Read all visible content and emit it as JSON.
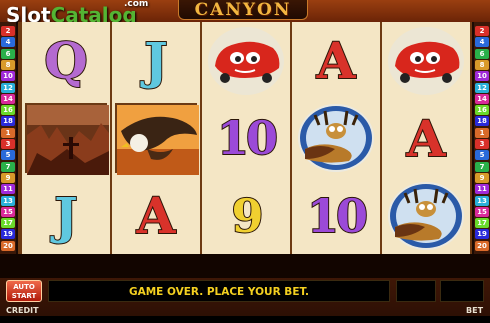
{
  "brand": {
    "part1": "Slot",
    "part2": "Catalog",
    "suffix": ".com"
  },
  "game": {
    "title": "CANYON"
  },
  "paylines": {
    "left": [
      "2",
      "4",
      "6",
      "8",
      "10",
      "12",
      "14",
      "16",
      "18",
      "1",
      "3",
      "5",
      "7",
      "9",
      "11",
      "13",
      "15",
      "17",
      "19",
      "20"
    ],
    "right": [
      "2",
      "4",
      "6",
      "8",
      "10",
      "12",
      "14",
      "16",
      "18",
      "1",
      "3",
      "5",
      "7",
      "9",
      "11",
      "13",
      "15",
      "17",
      "19",
      "20"
    ],
    "colors": [
      "#d9302a",
      "#2a6ad9",
      "#2ab04a",
      "#d99a2a",
      "#a02ad9",
      "#2ab0d9",
      "#d92a9a",
      "#6ad92a",
      "#2a2ad9",
      "#d96a2a"
    ]
  },
  "reels": [
    [
      {
        "type": "letter",
        "value": "Q",
        "color": "#b46ad0"
      },
      {
        "type": "image",
        "value": "canyon-scene-icon"
      },
      {
        "type": "letter",
        "value": "J",
        "color": "#5fc8e0"
      }
    ],
    [
      {
        "type": "letter",
        "value": "J",
        "color": "#5fc8e0"
      },
      {
        "type": "image",
        "value": "eagle-icon"
      },
      {
        "type": "letter",
        "value": "A",
        "color": "#d8322a"
      }
    ],
    [
      {
        "type": "image",
        "value": "red-car-icon"
      },
      {
        "type": "number",
        "value": "10",
        "color": "#9b4ad8"
      },
      {
        "type": "number",
        "value": "9",
        "color": "#f0d030"
      }
    ],
    [
      {
        "type": "letter",
        "value": "A",
        "color": "#d8322a"
      },
      {
        "type": "image",
        "value": "moose-icon"
      },
      {
        "type": "number",
        "value": "10",
        "color": "#9b4ad8"
      }
    ],
    [
      {
        "type": "image",
        "value": "red-car-icon"
      },
      {
        "type": "letter",
        "value": "A",
        "color": "#d8322a"
      },
      {
        "type": "image",
        "value": "moose-icon"
      }
    ]
  ],
  "controls": {
    "autostart_line1": "AUTO",
    "autostart_line2": "START",
    "message": "GAME OVER. PLACE YOUR BET.",
    "credit_label": "CREDIT",
    "bet_label": "BET"
  }
}
